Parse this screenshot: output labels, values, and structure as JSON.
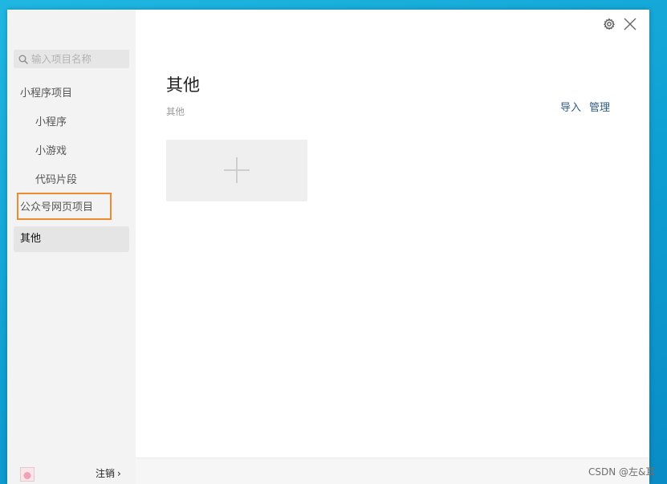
{
  "sidebar": {
    "search": {
      "placeholder": "输入项目名称",
      "icon": "search-icon"
    },
    "items": [
      {
        "label": "小程序项目",
        "type": "group"
      },
      {
        "label": "小程序",
        "type": "sub"
      },
      {
        "label": "小游戏",
        "type": "sub"
      },
      {
        "label": "代码片段",
        "type": "sub"
      },
      {
        "label": "公众号网页项目",
        "type": "group",
        "highlighted": true,
        "highlight_color": "#ef8b30"
      },
      {
        "label": "其他",
        "type": "group",
        "selected": true
      }
    ],
    "footer": {
      "avatar_icon": "avatar-image",
      "logout_label": "注销",
      "logout_chevron": "›"
    }
  },
  "toolbar": {
    "settings_icon": "gear-icon",
    "close_icon": "close-icon"
  },
  "main": {
    "title": "其他",
    "subtitle": "其他",
    "actions": {
      "import_label": "导入",
      "manage_label": "管理"
    },
    "add_card_icon": "plus-icon"
  },
  "watermark": "CSDN @左&耳",
  "colors": {
    "desktop": "#13a9dc",
    "link": "#2f5b87",
    "highlight_border": "#ef8b30",
    "sidebar_bg": "#f3f3f3",
    "selected_bg": "#e5e5e5"
  }
}
